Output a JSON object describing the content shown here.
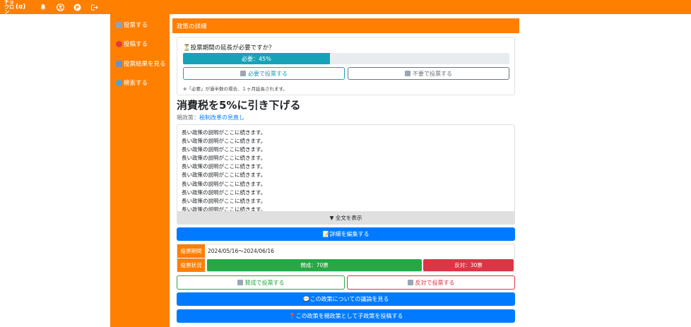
{
  "topbar": {
    "logo_line1": "チョウロン",
    "logo_alpha": "(α)",
    "icons": [
      "bell-icon",
      "user-icon",
      "p-badge-icon",
      "logout-icon"
    ]
  },
  "sidebar": {
    "items": [
      {
        "label": "投票する",
        "icon": "ballot-box-icon"
      },
      {
        "label": "投稿する",
        "icon": "pin-icon"
      },
      {
        "label": "投票結果を見る",
        "icon": "bar-chart-icon"
      },
      {
        "label": "検索する",
        "icon": "search-icon"
      }
    ]
  },
  "header": {
    "title": "政策の詳細"
  },
  "extension": {
    "question": "⏳投票期間の延長が必要ですか？",
    "progress_label": "必要：45%",
    "progress_value": 45,
    "need_button": "必要で投票する",
    "no_need_button": "不要で投票する",
    "note": "※「必要」が過半数の場合、１ヶ月延長されます。"
  },
  "policy": {
    "title": "消費税を5%に引き下げる",
    "parent_label": "親政策：",
    "parent_link": "税制改革の見直し",
    "description_line": "長い政策の説明がここに続きます。",
    "expand_label": "▼ 全文を表示",
    "edit_button": "📝詳細を編集する"
  },
  "voting": {
    "period_label": "投票期間",
    "period_value": "2024/05/16〜2024/06/16",
    "status_label": "投票状況",
    "yes_text": "賛成：70票",
    "no_text": "反対：30票",
    "yes_button": "賛成で投票する",
    "no_button": "反対で投票する"
  },
  "actions": {
    "discussion_button": "💬この政策についての議論を見る",
    "child_button": "📍この政策を親政策として子政策を投稿する"
  },
  "colors": {
    "brand": "#ff7f00",
    "primary": "#007bff",
    "info": "#17a2b8",
    "success": "#28a745",
    "danger": "#dc3545"
  }
}
